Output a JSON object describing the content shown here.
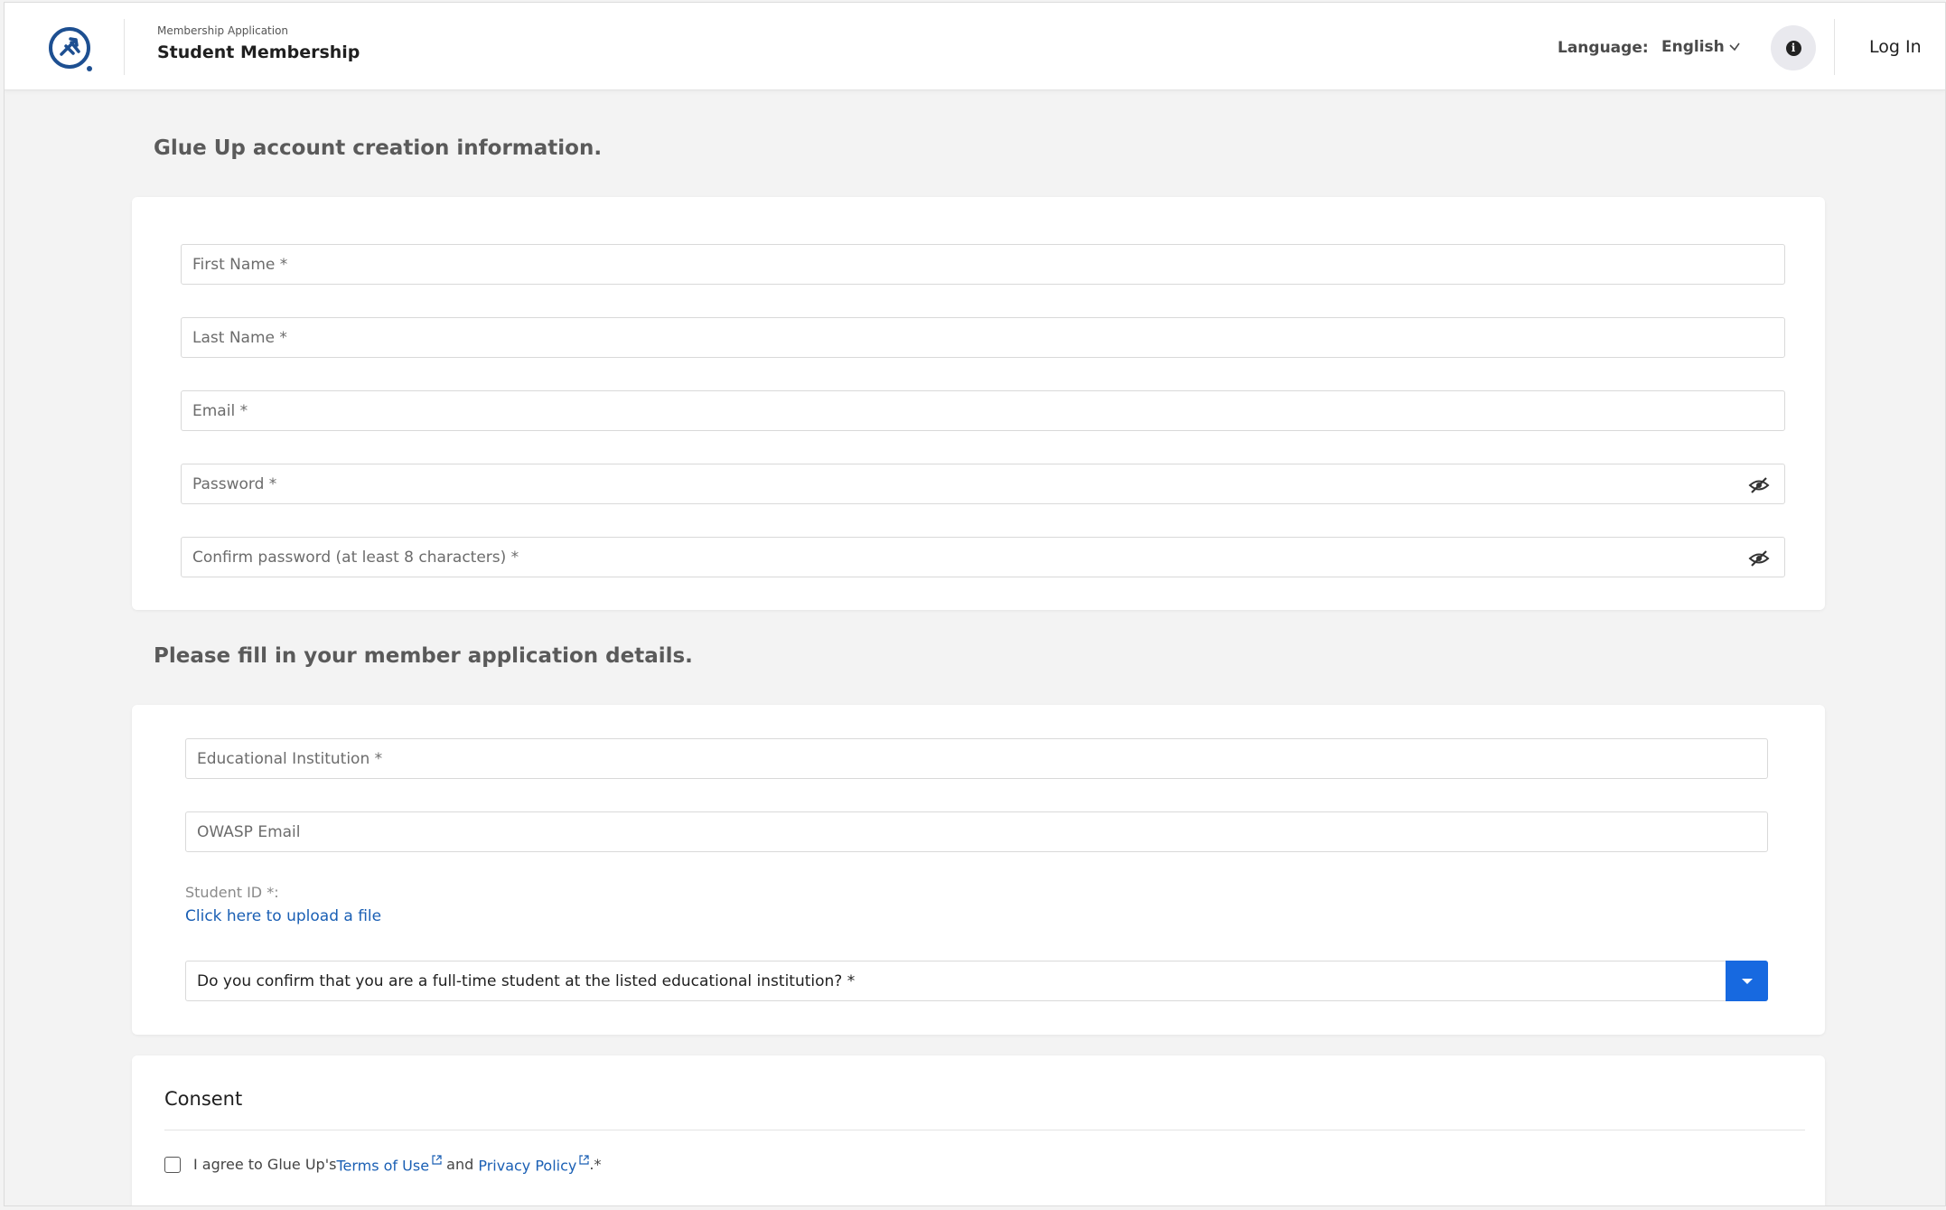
{
  "header": {
    "subtitle": "Membership Application",
    "title": "Student Membership",
    "language_label": "Language:",
    "language_value": "English",
    "info_glyph": "i",
    "login_label": "Log In"
  },
  "account_section": {
    "title": "Glue Up account creation information.",
    "fields": {
      "first_name": "First Name *",
      "last_name": "Last Name *",
      "email": "Email *",
      "password": "Password *",
      "confirm_password": "Confirm password (at least 8 characters) *"
    }
  },
  "application_section": {
    "title": "Please fill in your member application details.",
    "fields": {
      "institution": "Educational Institution *",
      "owasp_email": "OWASP Email"
    },
    "student_id_label": "Student ID *:",
    "upload_link": "Click here to upload a file",
    "confirm_select": "Do you confirm that you are a full-time student at the listed educational institution? *"
  },
  "consent": {
    "title": "Consent",
    "text_before": "I agree to Glue Up's ",
    "terms_link": "Terms of Use",
    "text_and": " and ",
    "privacy_link": "Privacy Policy",
    "text_after": ".*",
    "checked": false
  },
  "colors": {
    "accent": "#1769e0",
    "link": "#1a5fb4",
    "logo": "#1d4f91",
    "background": "#f3f3f3"
  },
  "icons": [
    "owasp-logo",
    "chevron-down-icon",
    "info-icon",
    "eye-slash-icon",
    "caret-down-icon",
    "external-link-icon"
  ]
}
